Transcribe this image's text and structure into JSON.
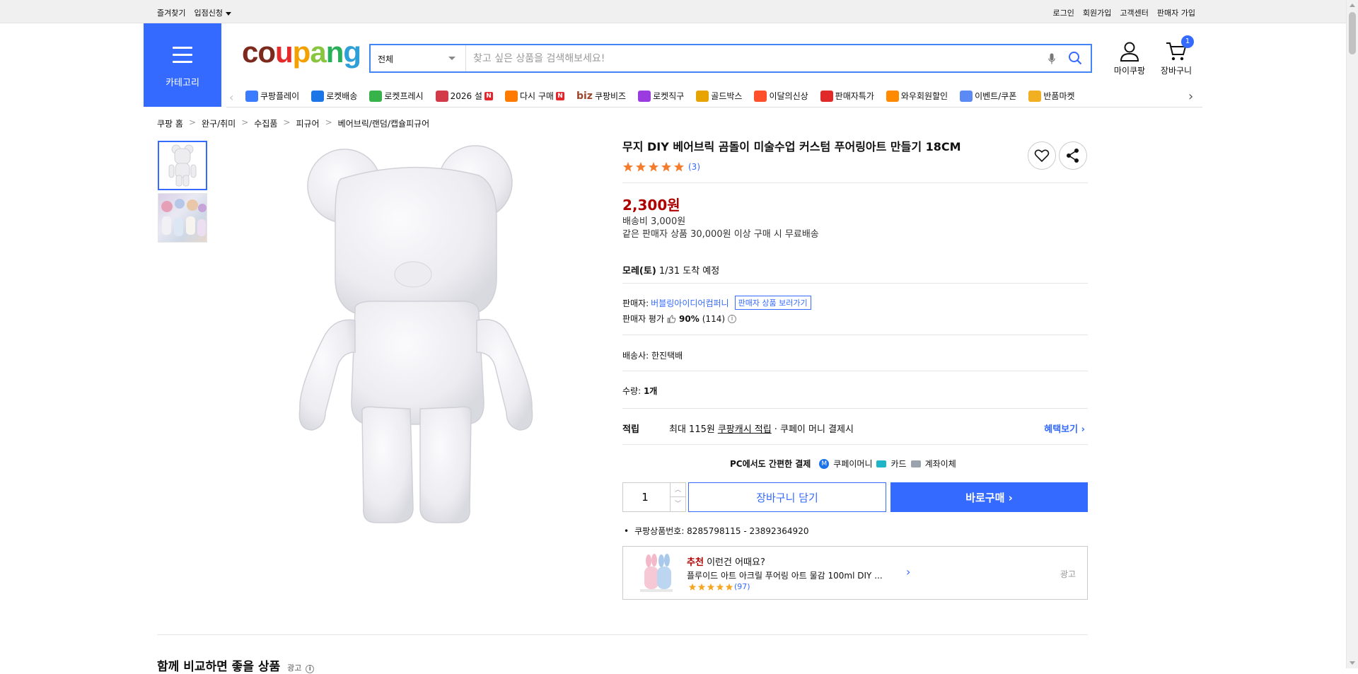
{
  "topbar": {
    "left": [
      "즐겨찾기",
      "입점신청"
    ],
    "right": [
      "로그인",
      "회원가입",
      "고객센터",
      "판매자 가입"
    ]
  },
  "header": {
    "category_label": "카테고리",
    "logo_letters": [
      {
        "ch": "c",
        "color": "#7b2a1d"
      },
      {
        "ch": "o",
        "color": "#7b2a1d"
      },
      {
        "ch": "u",
        "color": "#e32b2b"
      },
      {
        "ch": "p",
        "color": "#f2a100"
      },
      {
        "ch": "a",
        "color": "#8ac53f"
      },
      {
        "ch": "n",
        "color": "#2aaf5a"
      },
      {
        "ch": "g",
        "color": "#2f9fd8"
      }
    ],
    "search_scope": "전체",
    "search_placeholder": "찾고 싶은 상품을 검색해보세요!",
    "mycoupang": "마이쿠팡",
    "cart": "장바구니",
    "cart_count": "1"
  },
  "nav": [
    {
      "label": "쿠팡플레이",
      "color": "#3b7cff",
      "badge": ""
    },
    {
      "label": "로켓배송",
      "color": "#1c76e8",
      "badge": ""
    },
    {
      "label": "로켓프레시",
      "color": "#37b34a",
      "badge": ""
    },
    {
      "label": "2026 설",
      "color": "#d23a4a",
      "badge": "N"
    },
    {
      "label": "다시 구매",
      "color": "#ff7a00",
      "badge": "N"
    },
    {
      "label": "쿠팡비즈",
      "color": "#a0442b",
      "badge": "",
      "prefix": "biz"
    },
    {
      "label": "로켓직구",
      "color": "#9b3ce0",
      "badge": ""
    },
    {
      "label": "골드박스",
      "color": "#e7a400",
      "badge": ""
    },
    {
      "label": "이달의신상",
      "color": "#ff4f2b",
      "badge": ""
    },
    {
      "label": "판매자특가",
      "color": "#e02a2a",
      "badge": ""
    },
    {
      "label": "와우회원할인",
      "color": "#ff8a00",
      "badge": ""
    },
    {
      "label": "이벤트/쿠폰",
      "color": "#5b8af5",
      "badge": ""
    },
    {
      "label": "반품마켓",
      "color": "#f0b022",
      "badge": ""
    }
  ],
  "breadcrumb": [
    "쿠팡 홈",
    "완구/취미",
    "수집품",
    "피규어",
    "베어브릭/랜덤/캡슐피규어"
  ],
  "product": {
    "title": "무지 DIY 베어브릭 곰돌이 미술수업 커스텀 푸어링아트 만들기 18CM",
    "rating_count": "(3)",
    "rating_stars": 5,
    "price": "2,300원",
    "shipping_fee": "배송비 3,000원",
    "free_shipping": "같은 판매자 상품 30,000원 이상 구매 시 무료배송",
    "arrival_day": "모레(토)",
    "arrival_rest": "1/31 도착 예정",
    "seller_label": "판매자:",
    "seller_name": "버블링아이디어컴퍼니",
    "seller_link": "판매자 상품 보러가기",
    "seller_rating_label": "판매자 평가",
    "seller_rating_pct": "90%",
    "seller_rating_count": "(114)",
    "carrier_label": "배송사:",
    "carrier_name": "한진택배",
    "qty_label": "수량:",
    "qty_value": "1개",
    "reward_label": "적립",
    "reward_pre": "최대 115원",
    "reward_link": "쿠팡캐시 적립",
    "reward_post": "· 쿠페이 머니 결제시",
    "reward_more": "혜택보기",
    "pay_label": "PC에서도 간편한 결제",
    "pay_methods": [
      "쿠페이머니",
      "카드",
      "계좌이체"
    ],
    "qty_input": "1",
    "cart_button": "장바구니 담기",
    "buy_button": "바로구매",
    "product_id": "쿠팡상품번호: 8285798115 - 23892364920"
  },
  "recommend": {
    "prefix": "추천",
    "heading": "이런건 어때요?",
    "name": "플루이드 아트 아크릴 푸어링 아트 물감 100ml DIY ...",
    "count": "(97)",
    "ad": "광고"
  },
  "compare": {
    "title": "함께 비교하면 좋을 상품",
    "ad": "광고"
  },
  "colors": {
    "accent": "#346aff",
    "price": "#ae0000",
    "star": "#f57c2c"
  }
}
